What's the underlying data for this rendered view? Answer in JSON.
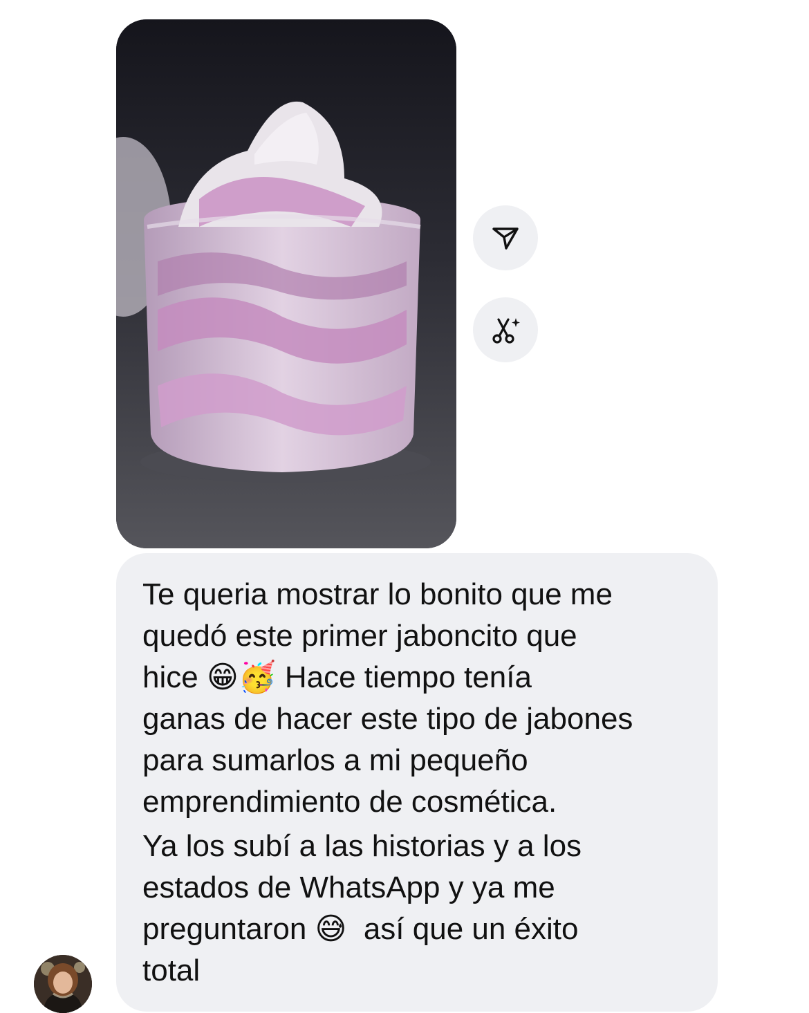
{
  "conversation": {
    "shared_image": {
      "alt": "Crema batida rosa y blanca en un frasco transparente"
    },
    "actions": {
      "share_icon": "send-paper-plane-icon",
      "remix_icon": "scissors-sparkle-icon"
    },
    "message": {
      "paragraph_1": "Te queria mostrar lo bonito que me\nquedó este primer jaboncito que\nhice 😁🥳 Hace tiempo tenía\nganas de hacer este tipo de jabones\npara sumarlos a mi pequeño\nemprendimiento de cosmética.",
      "paragraph_2": "Ya los subí a las historias y a los\nestados de WhatsApp y ya me\npreguntaron 😅  así que un éxito\ntotal"
    },
    "sender": {
      "avatar_icon": "user-avatar"
    }
  },
  "colors": {
    "bubble": "#eff0f3",
    "button": "#eff0f3",
    "text": "#111111"
  }
}
